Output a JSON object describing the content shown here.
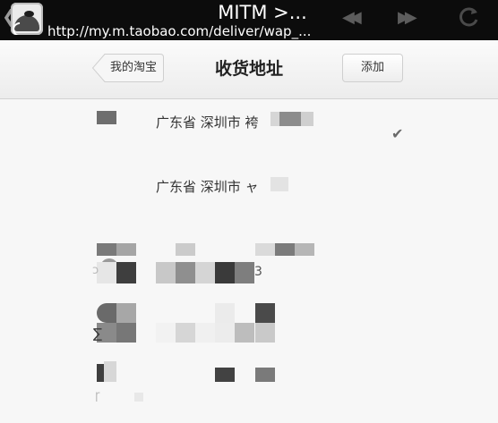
{
  "topbar": {
    "title": "MITM >...",
    "url": "http://my.m.taobao.com/deliver/wap_...",
    "icons": [
      "back-chevron-icon",
      "app-icon",
      "previous-icon",
      "next-icon",
      "reload-icon"
    ]
  },
  "header": {
    "back_label": "我的淘宝",
    "title": "收货地址",
    "add_label": "添加"
  },
  "addresses": [
    {
      "text": "广东省 深圳市 袴",
      "selected": true
    },
    {
      "text": "广东省 深圳市 ャ",
      "selected": false
    }
  ],
  "fragments": {
    "digit": "3",
    "mark1": "ɔ",
    "mark2": "∑",
    "mark3": "ɼ"
  }
}
